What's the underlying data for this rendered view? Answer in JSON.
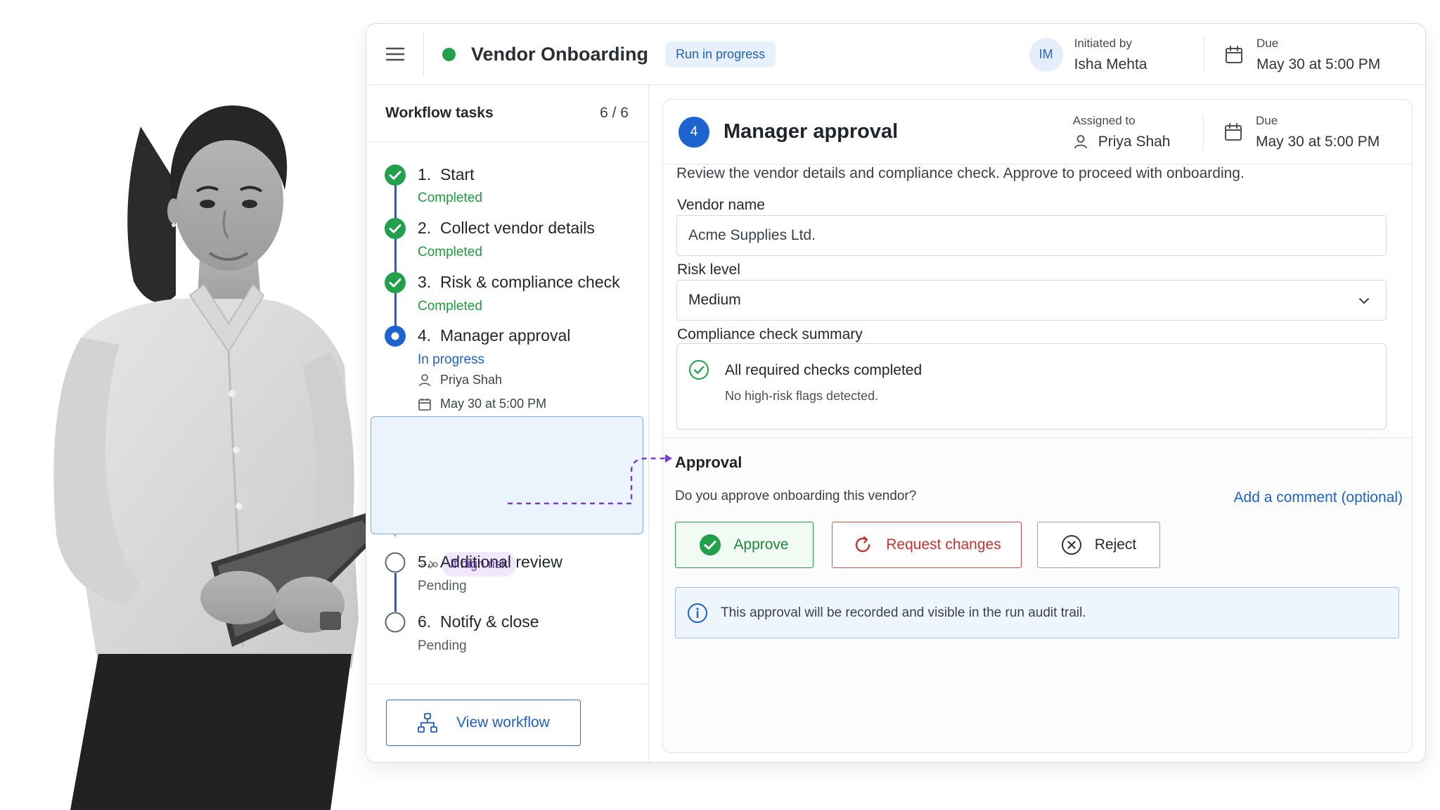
{
  "header": {
    "menu_icon": "hamburger-menu-icon",
    "title": "Vendor Onboarding",
    "status_badge": "Run in progress",
    "status_color": "#22a04b",
    "initiator_avatar": "IM",
    "initiator_label": "Initiated by",
    "initiator_name": "Isha Mehta",
    "due_label": "Due",
    "due_value": "May 30 at 5:00 PM"
  },
  "sidebar": {
    "title": "Workflow tasks",
    "count": "6 / 6",
    "tasks": [
      {
        "number": "1.",
        "title": "Start",
        "status": "Completed",
        "state": "done"
      },
      {
        "number": "2.",
        "title": "Collect vendor details",
        "status": "Completed",
        "state": "done"
      },
      {
        "number": "3.",
        "title": "Risk & compliance check",
        "status": "Completed",
        "state": "done"
      },
      {
        "number": "4.",
        "title": "Manager approval",
        "status": "In progress",
        "state": "active",
        "assignee": "Priya Shah",
        "due": "May 30 at 5:00 PM"
      },
      {
        "number": "5.",
        "title": "Additional review",
        "status": "Pending",
        "state": "pending"
      },
      {
        "number": "6.",
        "title": "Notify & close",
        "status": "Pending",
        "state": "pending"
      }
    ],
    "branch_label": "If high risk",
    "view_workflow_label": "View workflow"
  },
  "main": {
    "step_number": "4",
    "title": "Manager approval",
    "assigned_label": "Assigned to",
    "assigned_name": "Priya Shah",
    "due_label": "Due",
    "due_value": "May 30 at 5:00 PM",
    "description": "Review the vendor details and compliance check. Approve to proceed with onboarding.",
    "vendor_name_label": "Vendor name",
    "vendor_name_value": "Acme Supplies Ltd.",
    "risk_level_label": "Risk level",
    "risk_level_value": "Medium",
    "compliance_label": "Compliance check summary",
    "compliance_title": "All required checks completed",
    "compliance_detail": "No high-risk flags detected."
  },
  "approval": {
    "title": "Approval",
    "question": "Do you approve onboarding this vendor?",
    "comment_link": "Add a comment (optional)",
    "approve_label": "Approve",
    "request_changes_label": "Request changes",
    "reject_label": "Reject",
    "info_text": "This approval will be recorded and visible in the run audit trail."
  },
  "colors": {
    "accent": "#1d64d0",
    "success": "#1f9a3d",
    "danger": "#c73131",
    "branch": "#7a3ec9"
  }
}
